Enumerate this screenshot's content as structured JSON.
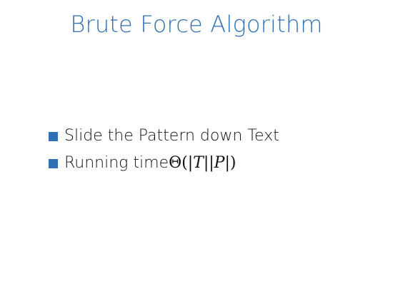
{
  "slide": {
    "title": "Brute Force Algorithm",
    "bullets": [
      {
        "text": "Slide the Pattern down Text"
      },
      {
        "prefix": "Running time ",
        "math": {
          "theta": "Θ",
          "open": "(",
          "bar1": "|",
          "T": "T",
          "bar2": "||",
          "P": "P",
          "bar3": "|",
          "close": ")"
        }
      }
    ],
    "colors": {
      "title": "#2f6fb3",
      "bullet": "#2f6fb3",
      "text": "#111111",
      "background": "#ffffff"
    }
  }
}
